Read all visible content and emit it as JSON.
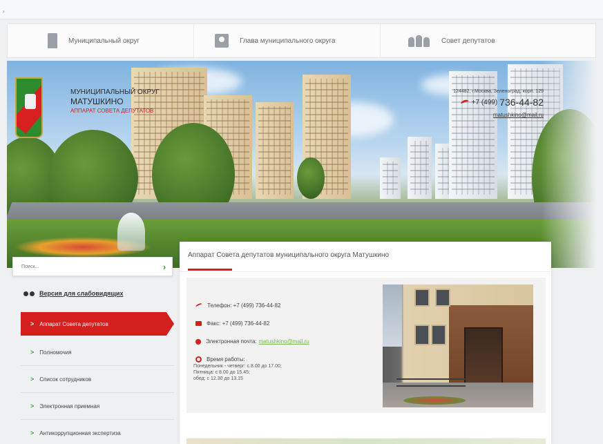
{
  "top_bar": {
    "mark": "›"
  },
  "menu": {
    "items": [
      {
        "label": "Муниципальный округ",
        "icon": "document-icon"
      },
      {
        "label": "Глава муниципального округа",
        "icon": "person-badge-icon"
      },
      {
        "label": "Совет депутатов",
        "icon": "group-icon"
      }
    ]
  },
  "header": {
    "org_line1": "МУНИЦИПАЛЬНЫЙ ОКРУГ",
    "org_line2": "МАТУШКИНО",
    "org_line3": "АППАРАТ СОВЕТА ДЕПУТАТОВ",
    "address": "124482, г.Москва, Зеленоград, корп. 129",
    "phone_prefix": "+7 (499)",
    "phone_number": "736-44-82",
    "email": "matushkino@mail.ru"
  },
  "search": {
    "placeholder": "Поиск...",
    "go_label": "›"
  },
  "accessible_version": {
    "label": "Версия для слабовидящих"
  },
  "sidebar": {
    "items": [
      {
        "label": "Аппарат Совета депутатов",
        "active": true
      },
      {
        "label": "Полномочия",
        "active": false
      },
      {
        "label": "Список сотрудников",
        "active": false
      },
      {
        "label": "Электронная приемная",
        "active": false
      },
      {
        "label": "Антикоррупционная экспертиза",
        "active": false
      }
    ],
    "arrow": ">"
  },
  "content": {
    "title": "Аппарат Совета депутатов муниципального округа Матушкино",
    "phone_label": "Телефон:",
    "phone_value": "+7 (499) 736-44-82",
    "fax_label": "Факс:",
    "fax_value": "+7 (499) 736-44-82",
    "email_label": "Электронная почта:",
    "email_value": "matushkino@mail.ru",
    "hours_label": "Время работы:",
    "hours_line1": "Понедельник - четверг: с 8.00 до 17.00;",
    "hours_line2": "Пятница: с 8.00 до 15.45;",
    "hours_line3": "обед: с 12.30 до 13.15"
  },
  "colors": {
    "accent_red": "#d41f1f",
    "accent_green": "#3aa53a",
    "emblem_green": "#2e8b2e"
  }
}
